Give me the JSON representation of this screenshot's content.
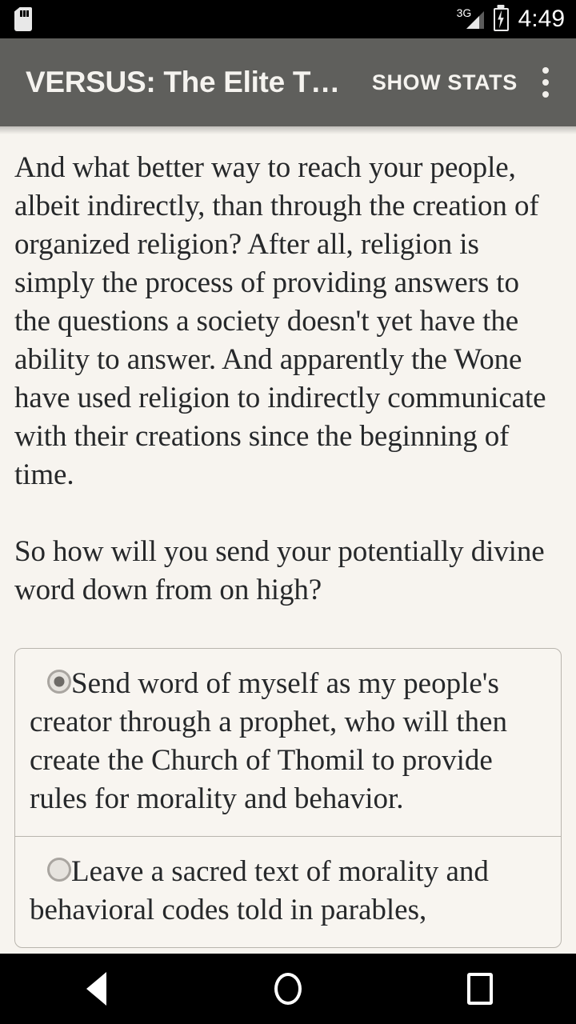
{
  "status_bar": {
    "sd_icon": "sd-card-icon",
    "network_label": "3G",
    "signal_icon": "signal-bars-icon",
    "battery_icon": "battery-charging-icon",
    "time": "4:49",
    "background_color": "#000000"
  },
  "app_bar": {
    "title": "VERSUS: The Elite T…",
    "action_label": "SHOW STATS",
    "overflow_icon": "overflow-menu-icon",
    "background_color": "#5f5f5c",
    "text_color": "#f5f3ef"
  },
  "story": {
    "paragraphs": [
      "And what better way to reach your people, albeit indirectly, than through the creation of organized religion? After all, religion is simply the process of providing answers to the questions a society doesn't yet have the ability to answer. And apparently the Wone have used religion to indirectly communicate with their creations since the beginning of time.",
      "So how will you send your potentially divine word down from on high?"
    ],
    "background_color": "#f7f4ef",
    "text_color": "#26282a"
  },
  "choices": [
    {
      "text": "Send word of myself as my people's creator through a prophet, who will then create the Church of Thomil to provide rules for morality and behavior.",
      "selected": true
    },
    {
      "text": "Leave a sacred text of morality and behavioral codes told in parables,",
      "selected": false
    }
  ],
  "nav_bar": {
    "back_label": "back-button",
    "home_label": "home-button",
    "recents_label": "recents-button",
    "background_color": "#000000"
  }
}
